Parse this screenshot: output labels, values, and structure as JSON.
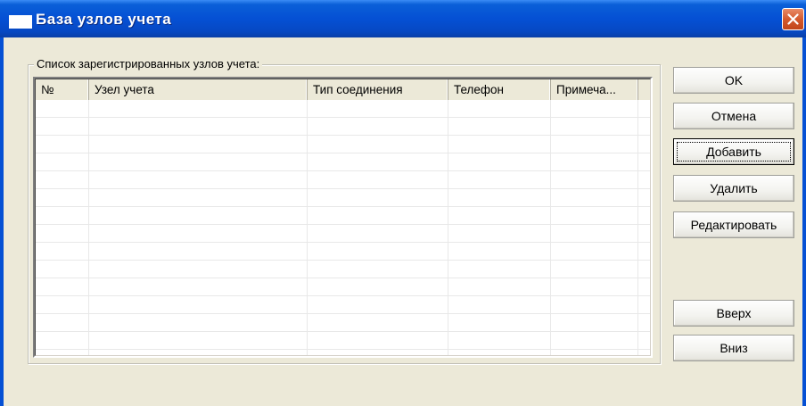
{
  "window": {
    "title": "База узлов учета"
  },
  "group": {
    "label": "Список зарегистрированных узлов учета:"
  },
  "table": {
    "columns": [
      "№",
      "Узел учета",
      "Тип соединения",
      "Телефон",
      "Примеча..."
    ],
    "rows": []
  },
  "buttons": {
    "ok": "OK",
    "cancel": "Отмена",
    "add": "Добавить",
    "delete": "Удалить",
    "edit": "Редактировать",
    "up": "Вверх",
    "down": "Вниз"
  },
  "icons": {
    "close": "close-icon",
    "app": "window-icon"
  },
  "colors": {
    "titlebar": "#0550d4",
    "background": "#ece9d8",
    "close": "#d45a2e"
  }
}
